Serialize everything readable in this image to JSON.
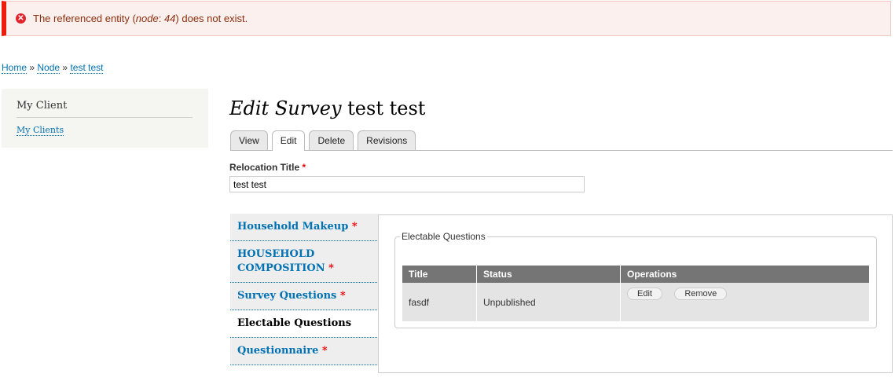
{
  "message": {
    "pre": "The referenced entity (",
    "em1": "node",
    "mid": ": ",
    "em2": "44",
    "post": ") does not exist.",
    "icon": "error-icon"
  },
  "breadcrumb": [
    "Home",
    "Node",
    "test test"
  ],
  "breadcrumb_sep": "»",
  "sidebar": {
    "title": "My Client",
    "link": "My Clients"
  },
  "page_title": {
    "em": "Edit Survey",
    "rest": " test test"
  },
  "tabs": [
    "View",
    "Edit",
    "Delete",
    "Revisions"
  ],
  "form": {
    "label": "Relocation Title",
    "required": "*",
    "value": "test test"
  },
  "vertical_tabs": [
    {
      "label": "Household Makeup",
      "required": "*"
    },
    {
      "label": "HOUSEHOLD COMPOSITION",
      "required": "*"
    },
    {
      "label": "Survey Questions",
      "required": "*"
    },
    {
      "label": "Electable Questions",
      "required": ""
    },
    {
      "label": "Questionnaire",
      "required": "*"
    }
  ],
  "fieldset": {
    "legend": "Electable Questions",
    "headers": [
      "Title",
      "Status",
      "Operations"
    ],
    "rows": [
      {
        "title": "fasdf",
        "status": "Unpublished",
        "edit": "Edit",
        "remove": "Remove"
      }
    ]
  }
}
